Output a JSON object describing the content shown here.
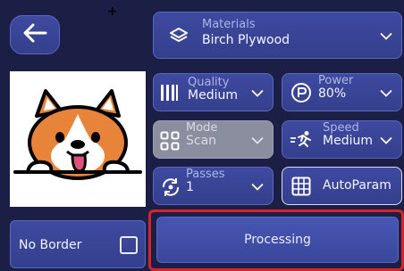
{
  "back": {
    "icon": "arrow-left-icon"
  },
  "image": {
    "subject": "corgi-dog-illustration"
  },
  "materials": {
    "label": "Materials",
    "value": "Birch Plywood",
    "icon": "layers-icon"
  },
  "quality": {
    "label": "Quality",
    "value": "Medium",
    "icon": "bars-icon"
  },
  "power": {
    "label": "Power",
    "value": "80%",
    "icon": "power-p-icon"
  },
  "mode": {
    "label": "Mode",
    "value": "Scan",
    "icon": "grid-squares-icon"
  },
  "speed": {
    "label": "Speed",
    "value": "Medium",
    "icon": "running-icon"
  },
  "passes": {
    "label": "Passes",
    "value": "1",
    "icon": "repeat-icon"
  },
  "autoparam": {
    "label": "AutoParam",
    "icon": "grid-icon"
  },
  "no_border": {
    "label": "No Border",
    "checked": false
  },
  "processing": {
    "label": "Processing"
  },
  "colors": {
    "background": "#1b1f45",
    "panel": "#3e4aa0",
    "highlight": "#d8232a",
    "disabled": "#8b8e9f"
  }
}
